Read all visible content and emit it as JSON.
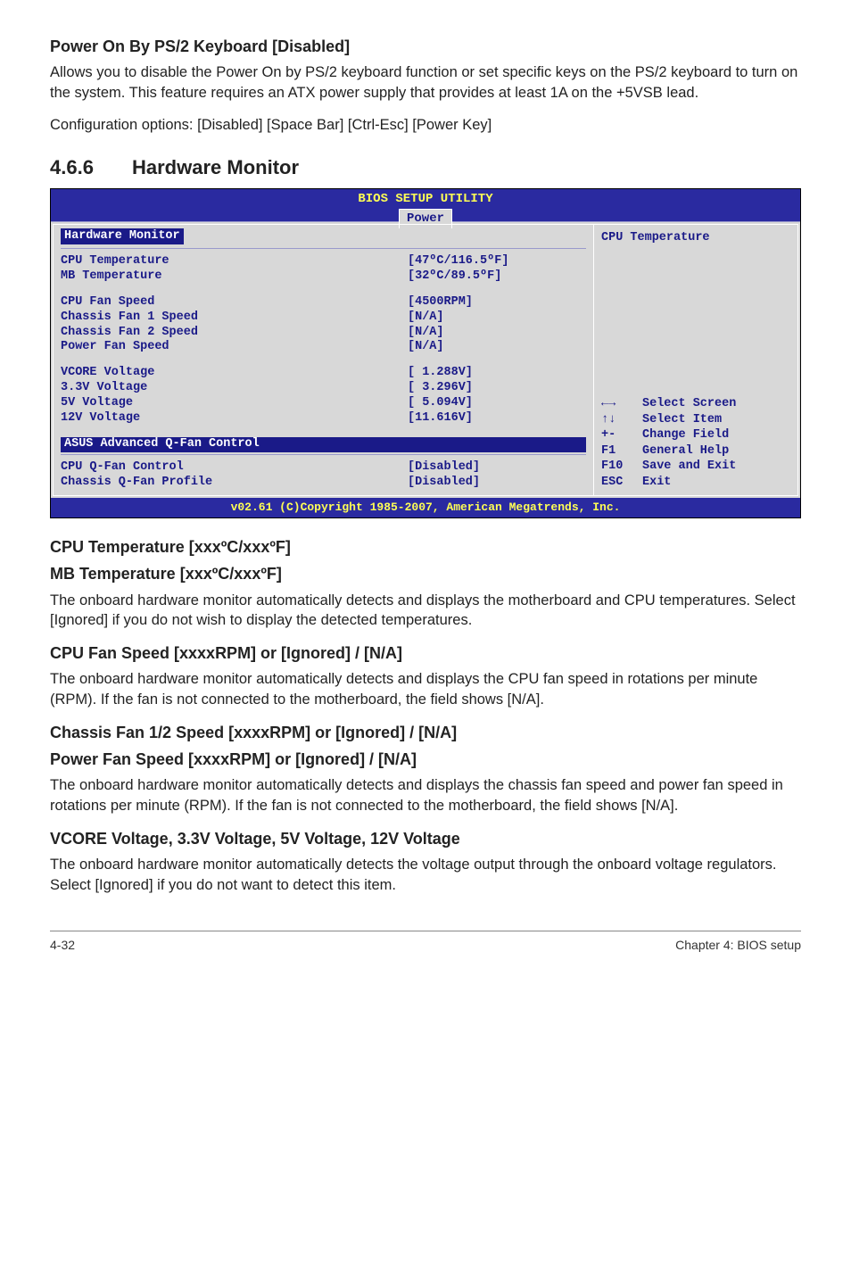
{
  "s1": {
    "title": "Power On By PS/2 Keyboard [Disabled]",
    "p1": "Allows you to disable the Power On by PS/2 keyboard function or set specific keys on the PS/2 keyboard to turn on the system. This feature requires an ATX power supply that provides at least 1A on the +5VSB lead.",
    "p2": "Configuration options: [Disabled] [Space Bar] [Ctrl-Esc] [Power Key]"
  },
  "section": {
    "num": "4.6.6",
    "title": "Hardware Monitor"
  },
  "bios": {
    "top": "BIOS SETUP UTILITY",
    "tab": "Power",
    "panel_title": "Hardware Monitor",
    "rows": [
      {
        "lbl": "CPU Temperature",
        "val": "[47ºC/116.5ºF]"
      },
      {
        "lbl": "MB Temperature",
        "val": "[32ºC/89.5ºF]"
      }
    ],
    "rows2": [
      {
        "lbl": "CPU Fan Speed",
        "val": "[4500RPM]"
      },
      {
        "lbl": "Chassis Fan 1 Speed",
        "val": "[N/A]"
      },
      {
        "lbl": "Chassis Fan 2 Speed",
        "val": "[N/A]"
      },
      {
        "lbl": "Power Fan Speed",
        "val": "[N/A]"
      }
    ],
    "rows3": [
      {
        "lbl": "VCORE Voltage",
        "val": "[ 1.288V]"
      },
      {
        "lbl": "3.3V  Voltage",
        "val": "[ 3.296V]"
      },
      {
        "lbl": "5V    Voltage",
        "val": "[ 5.094V]"
      },
      {
        "lbl": "12V   Voltage",
        "val": "[11.616V]"
      }
    ],
    "adv": "ASUS Advanced Q-Fan Control",
    "rows4": [
      {
        "lbl": "CPU Q-Fan Control",
        "val": "[Disabled]"
      },
      {
        "lbl": "Chassis Q-Fan Profile",
        "val": "[Disabled]"
      }
    ],
    "help_title": "CPU Temperature",
    "help": [
      {
        "key": "←→",
        "txt": "Select Screen"
      },
      {
        "key": "↑↓",
        "txt": "Select Item"
      },
      {
        "key": "+-",
        "txt": "Change Field"
      },
      {
        "key": "F1",
        "txt": "General Help"
      },
      {
        "key": "F10",
        "txt": "Save and Exit"
      },
      {
        "key": "ESC",
        "txt": "Exit"
      }
    ],
    "footer": "v02.61 (C)Copyright 1985-2007, American Megatrends, Inc."
  },
  "s2": {
    "t1": "CPU Temperature [xxxºC/xxxºF]",
    "t2": "MB Temperature [xxxºC/xxxºF]",
    "p": "The onboard hardware monitor automatically detects and displays the motherboard and CPU temperatures. Select [Ignored] if you do not wish to display the detected temperatures."
  },
  "s3": {
    "t": "CPU Fan Speed [xxxxRPM] or [Ignored] / [N/A]",
    "p": "The onboard hardware monitor automatically detects and displays the CPU fan speed in rotations per minute (RPM). If the fan is not connected to the motherboard, the field shows [N/A]."
  },
  "s4": {
    "t1": "Chassis Fan 1/2 Speed [xxxxRPM] or [Ignored] / [N/A]",
    "t2": "Power Fan Speed [xxxxRPM] or [Ignored] / [N/A]",
    "p": "The onboard hardware monitor automatically detects and displays the chassis fan speed and power fan speed in rotations per minute (RPM). If the fan is not connected to the motherboard, the field shows [N/A]."
  },
  "s5": {
    "t": "VCORE Voltage, 3.3V Voltage, 5V Voltage, 12V Voltage",
    "p": "The onboard hardware monitor automatically detects the voltage output through the onboard voltage regulators. Select [Ignored] if you do not want to detect this item."
  },
  "footer": {
    "left": "4-32",
    "right": "Chapter 4: BIOS setup"
  }
}
